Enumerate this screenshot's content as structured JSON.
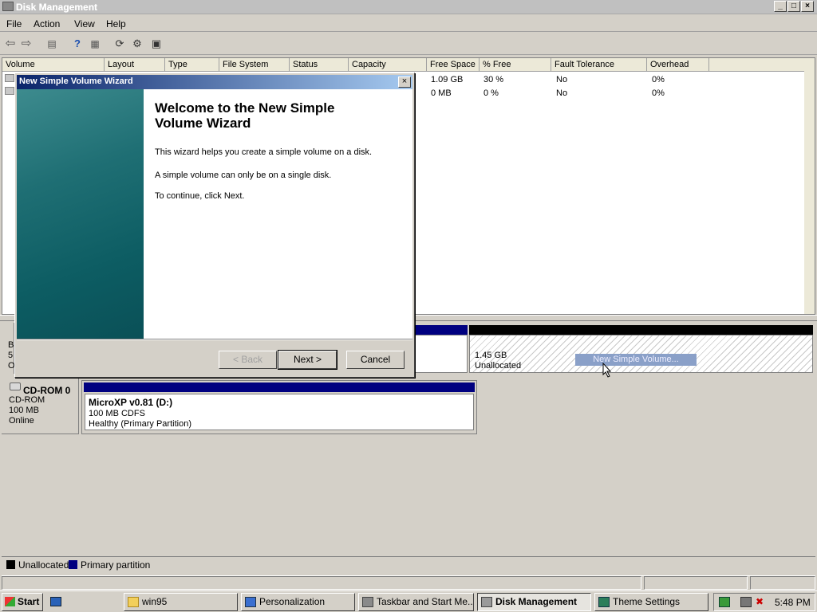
{
  "window": {
    "title": "Disk Management"
  },
  "menu": [
    "File",
    "Action",
    "View",
    "Help"
  ],
  "columns": [
    "Volume",
    "Layout",
    "Type",
    "File System",
    "Status",
    "Capacity",
    "Free Space",
    "% Free",
    "Fault Tolerance",
    "Overhead"
  ],
  "volume_rows": [
    {
      "free_space": "1.09 GB",
      "pct_free": "30 %",
      "fault": "No",
      "overhead": "0%"
    },
    {
      "free_space": "0 MB",
      "pct_free": "0 %",
      "fault": "No",
      "overhead": "0%"
    }
  ],
  "disk0": {
    "partial_label_chars": [
      "B",
      "5",
      "O"
    ],
    "unallocated_size": "1.45 GB",
    "unallocated_label": "Unallocated",
    "context_hint": "New Simple Volume..."
  },
  "cdrom": {
    "name": "CD-ROM 0",
    "type": "CD-ROM",
    "size": "100 MB",
    "status": "Online",
    "volume_name": "MicroXP v0.81  (D:)",
    "volume_detail": "100 MB CDFS",
    "volume_health": "Healthy (Primary Partition)"
  },
  "legend": {
    "unallocated": "Unallocated",
    "primary": "Primary partition"
  },
  "wizard": {
    "title": "New Simple Volume Wizard",
    "heading_line1": "Welcome to the New Simple",
    "heading_line2": "Volume Wizard",
    "para1": "This wizard helps you create a simple volume on a disk.",
    "para2": "A simple volume can only be on a single disk.",
    "para3": "To continue, click Next.",
    "back": "< Back",
    "next": "Next >",
    "cancel": "Cancel"
  },
  "taskbar": {
    "start": "Start",
    "tasks": [
      "win95",
      "Personalization",
      "Taskbar and Start Me...",
      "Disk Management",
      "Theme Settings"
    ],
    "clock": "5:48 PM"
  },
  "colors": {
    "primary_partition": "#000080",
    "unallocated": "#000000",
    "wizard_accent": "#0a246a"
  }
}
